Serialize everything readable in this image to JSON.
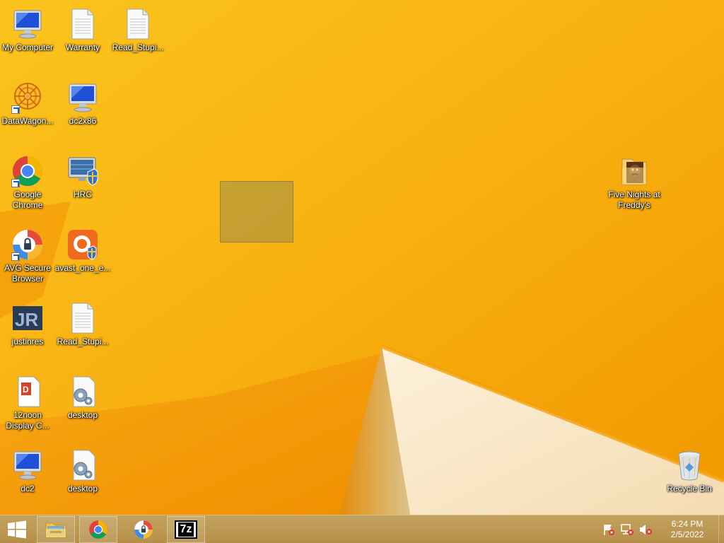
{
  "desktop": {
    "icons": [
      {
        "label": "My Computer",
        "icon": "computer-icon"
      },
      {
        "label": "Warranty",
        "icon": "text-file-icon"
      },
      {
        "label": "Read_Stupi...",
        "icon": "text-file-icon"
      },
      {
        "label": "DataWagon...",
        "icon": "datawagon-icon"
      },
      {
        "label": "dc2x86",
        "icon": "computer-icon"
      },
      {
        "label": "Google Chrome",
        "icon": "chrome-icon"
      },
      {
        "label": "HRC",
        "icon": "hrc-monitor-icon"
      },
      {
        "label": "AVG Secure Browser",
        "icon": "avg-browser-icon"
      },
      {
        "label": "avast_one_e...",
        "icon": "avast-installer-icon"
      },
      {
        "label": "justinres",
        "icon": "justinres-icon"
      },
      {
        "label": "Read_Stupi...",
        "icon": "text-file-icon"
      },
      {
        "label": "12noon Display C...",
        "icon": "pdf-file-icon"
      },
      {
        "label": "desktop",
        "icon": "settings-file-icon"
      },
      {
        "label": "dc2",
        "icon": "computer-icon"
      },
      {
        "label": "desktop",
        "icon": "settings-file-icon"
      },
      {
        "label": "Five Nights at Freddy's",
        "icon": "fnaf-folder-icon"
      },
      {
        "label": "Recycle Bin",
        "icon": "recycle-bin-icon"
      }
    ]
  },
  "taskbar": {
    "pinned": [
      "file-explorer-icon",
      "chrome-icon",
      "avg-browser-icon",
      "7zip-icon"
    ],
    "seven_zip_text": "7z",
    "clock": {
      "time": "6:24 PM",
      "date": "2/5/2022"
    }
  },
  "colors": {
    "wallpaper_orange": "#f5a800",
    "taskbar": "#b8934b"
  }
}
